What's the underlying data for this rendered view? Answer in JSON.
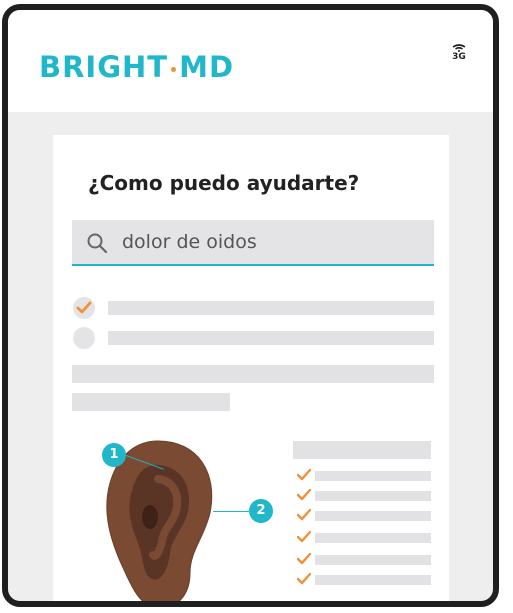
{
  "header": {
    "logo_left": "BRIGHT",
    "logo_right": "MD",
    "network_label": "3G"
  },
  "main": {
    "title": "¿Como puedo ayudarte?",
    "search": {
      "value": "dolor de oidos",
      "placeholder": ""
    },
    "options": [
      {
        "state": "checked"
      },
      {
        "state": "unchecked"
      }
    ],
    "diagram": {
      "callouts": [
        "1",
        "2"
      ]
    },
    "checklist_count_note": null
  },
  "colors": {
    "brand": "#1fb7c9",
    "accent": "#f0913a",
    "ear": "#7a4a32",
    "ear_inner": "#5a3424"
  },
  "icons": [
    "wifi-icon",
    "search-icon",
    "check-icon",
    "ear-illustration"
  ]
}
